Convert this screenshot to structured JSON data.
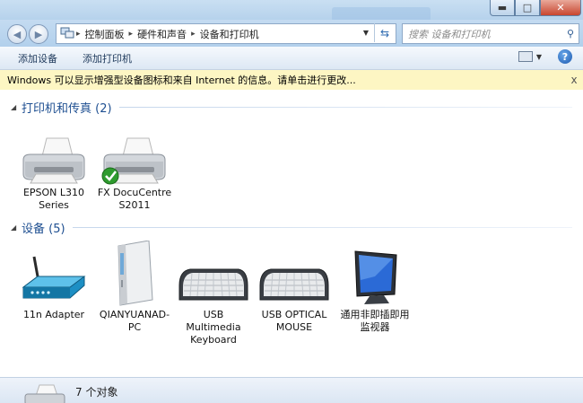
{
  "window": {
    "minimize": "▬",
    "maximize": "□",
    "close": "✕"
  },
  "address": {
    "segments": [
      "控制面板",
      "硬件和声音",
      "设备和打印机"
    ],
    "search_placeholder": "搜索 设备和打印机"
  },
  "toolbar": {
    "add_device": "添加设备",
    "add_printer": "添加打印机",
    "help": "?"
  },
  "infobar": {
    "message": "Windows 可以显示增强型设备图标和来自 Internet 的信息。请单击进行更改...",
    "close": "x"
  },
  "groups": {
    "printers": {
      "title": "打印机和传真 (2)",
      "items": [
        {
          "label": "EPSON L310\nSeries",
          "icon": "printer-icon",
          "default": false
        },
        {
          "label": "FX DocuCentre\nS2011",
          "icon": "printer-icon",
          "default": true
        }
      ]
    },
    "devices": {
      "title": "设备 (5)",
      "items": [
        {
          "label": "11n Adapter",
          "icon": "router-icon"
        },
        {
          "label": "QIANYUANAD-\nPC",
          "icon": "computer-tower-icon"
        },
        {
          "label": "USB Multimedia\nKeyboard",
          "icon": "keyboard-icon"
        },
        {
          "label": "USB OPTICAL\nMOUSE",
          "icon": "keyboard-icon"
        },
        {
          "label": "通用非即插即用\n监视器",
          "icon": "monitor-icon"
        }
      ]
    }
  },
  "status": {
    "count": "7 个对象"
  },
  "colors": {
    "accent": "#1e4f91",
    "infobar": "#fdf6c3",
    "check": "#2e9b2e"
  }
}
